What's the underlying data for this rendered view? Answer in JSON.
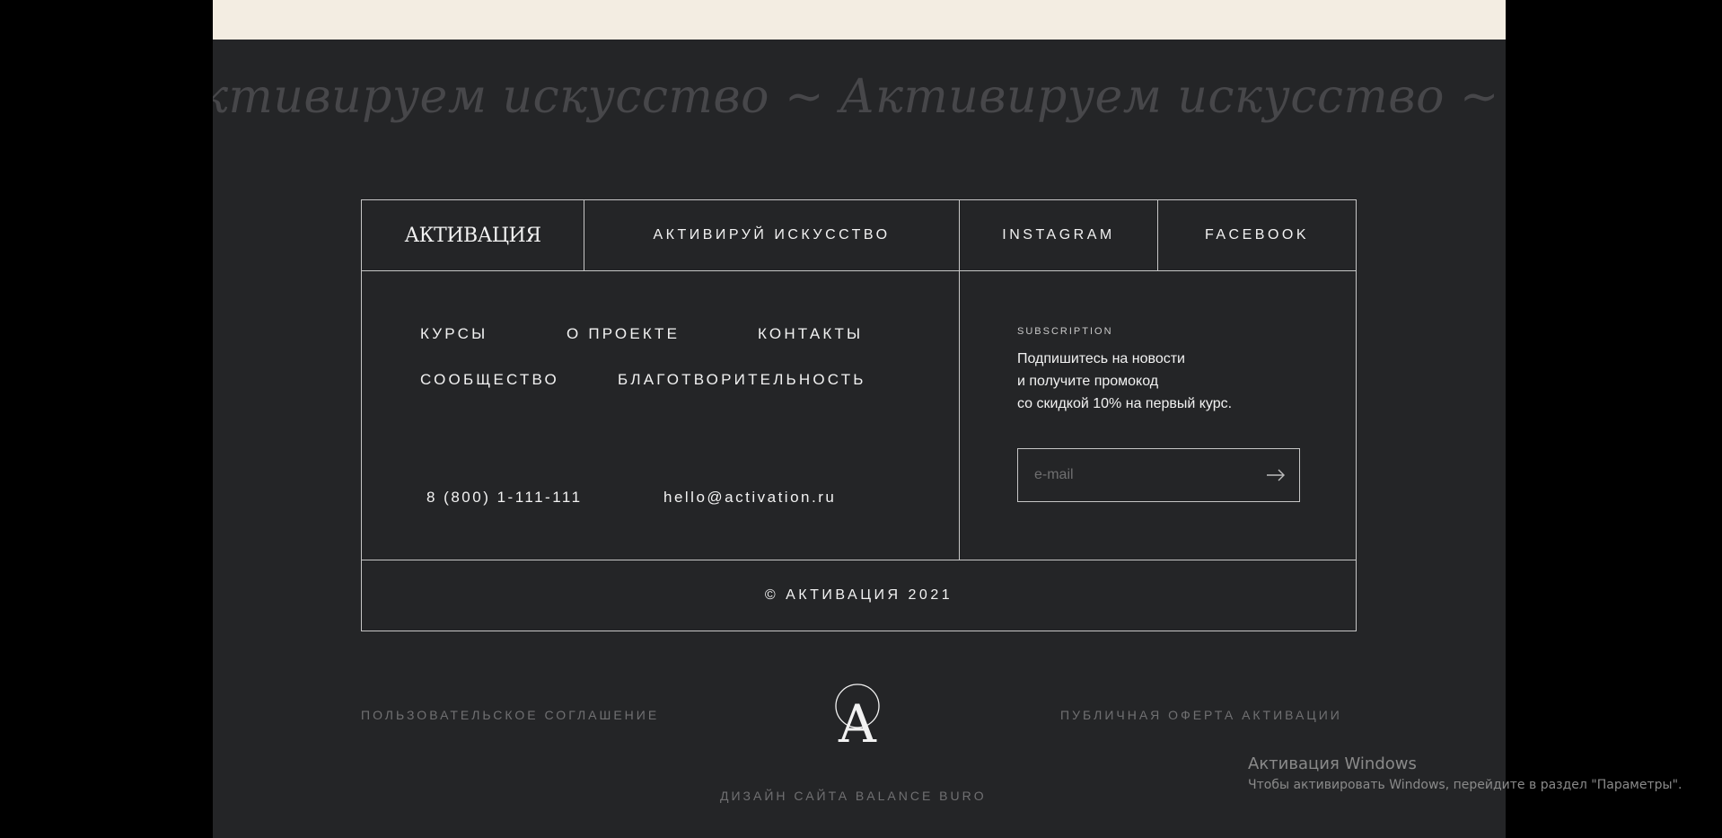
{
  "marquee": {
    "text": "ктивируем искусство ~ Активируем искусство ~ Активируем искусство ~ Активируем искусство"
  },
  "header": {
    "logo": "АКТИВАЦИЯ",
    "slogan": "АКТИВИРУЙ ИСКУССТВО",
    "instagram": "INSTAGRAM",
    "facebook": "FACEBOOK"
  },
  "nav": {
    "items": [
      "КУРСЫ",
      "О ПРОЕКТЕ",
      "КОНТАКТЫ",
      "СООБЩЕСТВО",
      "БЛАГОТВОРИТЕЛЬНОСТЬ"
    ]
  },
  "contacts": {
    "phone": "8 (800) 1-111-111",
    "email": "hello@activation.ru"
  },
  "subscription": {
    "label": "SUBSCRIPTION",
    "lines": [
      "Подпишитесь на новости",
      "и получите промокод",
      "со скидкой 10% на первый курс."
    ],
    "placeholder": "e-mail",
    "submit_icon": "arrow-right-icon"
  },
  "copyright": "© АКТИВАЦИЯ 2021",
  "bottom": {
    "agreement": "ПОЛЬЗОВАТЕЛЬСКОЕ СОГЛАШЕНИЕ",
    "offer": "ПУБЛИЧНАЯ ОФЕРТА АКТИВАЦИИ",
    "design": "ДИЗАЙН САЙТА BALANCE BURO",
    "monogram_letter": "A"
  },
  "windows_watermark": {
    "title": "Активация Windows",
    "text": "Чтобы активировать Windows, перейдите в раздел \"Параметры\"."
  },
  "colors": {
    "background": "#242527",
    "top_band": "#f3ede2",
    "text": "#f2f2f2",
    "muted": "#707072",
    "border": "#c6c6c6"
  }
}
